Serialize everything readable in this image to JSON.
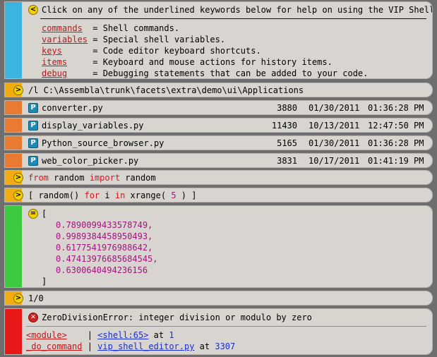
{
  "colors": {
    "help_bar": "#3cb4e0",
    "cmd_bar": "#f0ac10",
    "file_bar": "#e87a32",
    "result_bar": "#3cc840",
    "error_bar": "#e81818"
  },
  "help": {
    "icon": "less-than-icon",
    "intro": "Click on any of the underlined keywords below for help on using the VIP Shell:",
    "items": [
      {
        "keyword": "commands",
        "pad": "  ",
        "desc": "= Shell commands."
      },
      {
        "keyword": "variables",
        "pad": " ",
        "desc": "= Special shell variables."
      },
      {
        "keyword": "keys",
        "pad": "      ",
        "desc": "= Code editor keyboard shortcuts."
      },
      {
        "keyword": "items",
        "pad": "     ",
        "desc": "= Keyboard and mouse actions for history items."
      },
      {
        "keyword": "debug",
        "pad": "     ",
        "desc": "= Debugging statements that can be added to your code."
      }
    ]
  },
  "cd_command": "/l C:\\Assembla\\trunk\\facets\\extra\\demo\\ui\\Applications",
  "files": [
    {
      "name": "converter.py",
      "size": "3880",
      "date": "01/30/2011",
      "time": "01:36:28 PM"
    },
    {
      "name": "display_variables.py",
      "size": "11430",
      "date": "10/13/2011",
      "time": "12:47:50 PM"
    },
    {
      "name": "Python_source_browser.py",
      "size": "5165",
      "date": "01/30/2011",
      "time": "01:36:28 PM"
    },
    {
      "name": "web_color_picker.py",
      "size": "3831",
      "date": "10/17/2011",
      "time": "01:41:19 PM"
    }
  ],
  "import_cmd": {
    "kw1": "from",
    "mod": " random ",
    "kw2": "import",
    "name": " random"
  },
  "list_cmd": {
    "p1": "[ random() ",
    "kw1": "for",
    "p2": " i ",
    "kw2": "in",
    "p3": " xrange( ",
    "n": "5",
    "p4": " ) ]"
  },
  "result": {
    "open": "[",
    "values": [
      "0.7890099433578749,",
      "0.9989384458950493,",
      "0.6177541976988642,",
      "0.47413976685684545,",
      "0.6300640494236156"
    ],
    "close": "]"
  },
  "div_cmd": "1/0",
  "error": {
    "message": "ZeroDivisionError: integer division or modulo by zero",
    "frames": [
      {
        "func": "<module>",
        "pad": "    ",
        "loc": "<shell:65>",
        "at": " at ",
        "line": "1"
      },
      {
        "func": "_do_command",
        "pad": " ",
        "loc": "vip_shell_editor.py",
        "at": " at ",
        "line": "3307"
      }
    ]
  }
}
